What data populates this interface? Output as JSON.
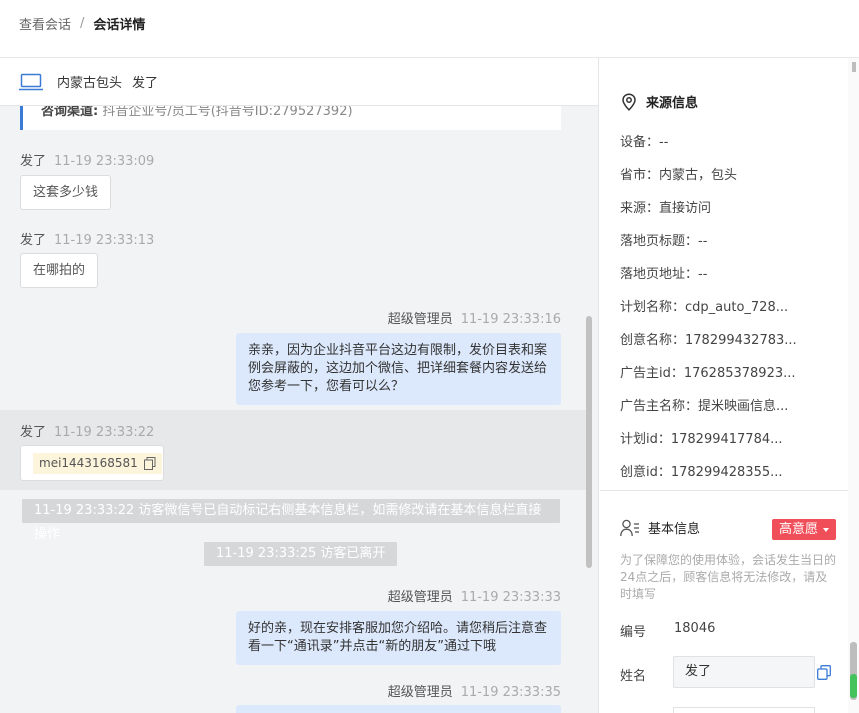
{
  "breadcrumb": {
    "parent": "查看会话",
    "separator": "/",
    "current": "会话详情"
  },
  "conversation": {
    "location": "内蒙古包头",
    "visitor_name": "发了"
  },
  "channel": {
    "label": "咨询渠道:",
    "value": "抖音企业号/员工号(抖音号ID:279527392)"
  },
  "messages": {
    "m1": {
      "sender": "发了",
      "time": "11-19 23:33:09",
      "text": "这套多少钱"
    },
    "m2": {
      "sender": "发了",
      "time": "11-19 23:33:13",
      "text": "在哪拍的"
    },
    "m3": {
      "sender": "超级管理员",
      "time": "11-19 23:33:16",
      "text": "亲亲，因为企业抖音平台这边有限制，发价目表和案例会屏蔽的，这边加个微信、把详细套餐内容发送给您参考一下，您看可以么？"
    },
    "m4": {
      "sender": "发了",
      "time": "11-19 23:33:22",
      "text": "mei1443168581"
    },
    "sys1": "11-19 23:33:22 访客微信号已自动标记右侧基本信息栏，如需修改请在基本信息栏直接操作",
    "sys2": "11-19 23:33:25 访客已离开",
    "m5": {
      "sender": "超级管理员",
      "time": "11-19 23:33:33",
      "text": "好的亲，现在安排客服加您介绍哈。请您稍后注意查看一下“通讯录”并点击“新的朋友”通过下哦"
    },
    "m6": {
      "sender": "超级管理员",
      "time": "11-19 23:33:35"
    }
  },
  "source_info": {
    "title": "来源信息",
    "rows": [
      "设备：--",
      "省市：内蒙古，包头",
      "来源：直接访问",
      "落地页标题：--",
      "落地页地址：--",
      "计划名称：cdp_auto_728...",
      "创意名称：178299432783...",
      "广告主id：176285378923...",
      "广告主名称：提米映画信息...",
      "计划id：178299417784...",
      "创意id：178299428355..."
    ]
  },
  "basic_info": {
    "title": "基本信息",
    "intent_badge": "高意愿",
    "note": "为了保障您的使用体验，会话发生当日的24点之后，顾客信息将无法修改，请及时填写",
    "id_label": "编号",
    "id_value": "18046",
    "name_label": "姓名",
    "name_value": "发了"
  },
  "colors": {
    "accent_blue": "#3a7bd5",
    "bubble_blue": "#dce8fb",
    "badge_red": "#f04f5a",
    "green": "#44c25c"
  }
}
